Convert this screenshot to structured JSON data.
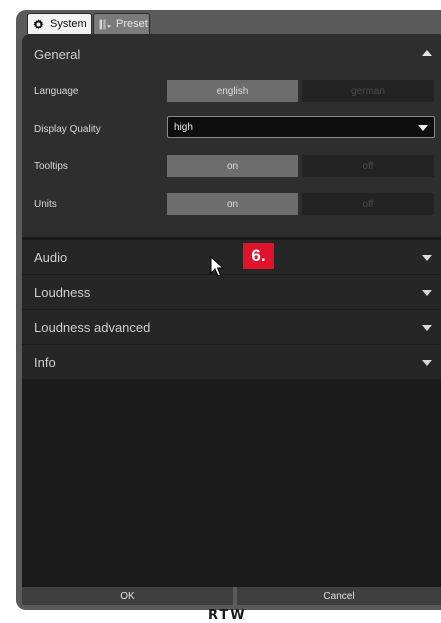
{
  "tabs": [
    {
      "label": "System",
      "icon": "gear-icon"
    },
    {
      "label": "Preset",
      "icon": "preset-icon"
    }
  ],
  "general": {
    "title": "General",
    "language": {
      "label": "Language",
      "options": [
        "english",
        "german"
      ],
      "selected": "english"
    },
    "display_quality": {
      "label": "Display Quality",
      "value": "high"
    },
    "tooltips": {
      "label": "Tooltips",
      "options": [
        "on",
        "off"
      ],
      "selected": "on"
    },
    "units": {
      "label": "Units",
      "options": [
        "on",
        "off"
      ],
      "selected": "on"
    }
  },
  "sections": [
    "Audio",
    "Loudness",
    "Loudness advanced",
    "Info"
  ],
  "footer": {
    "ok": "OK",
    "cancel": "Cancel"
  },
  "brand": "RTW",
  "callout": "6.",
  "colors": {
    "accent": "#e1122b",
    "panel": "#1b1b1b",
    "selected": "#6d6d6d"
  }
}
